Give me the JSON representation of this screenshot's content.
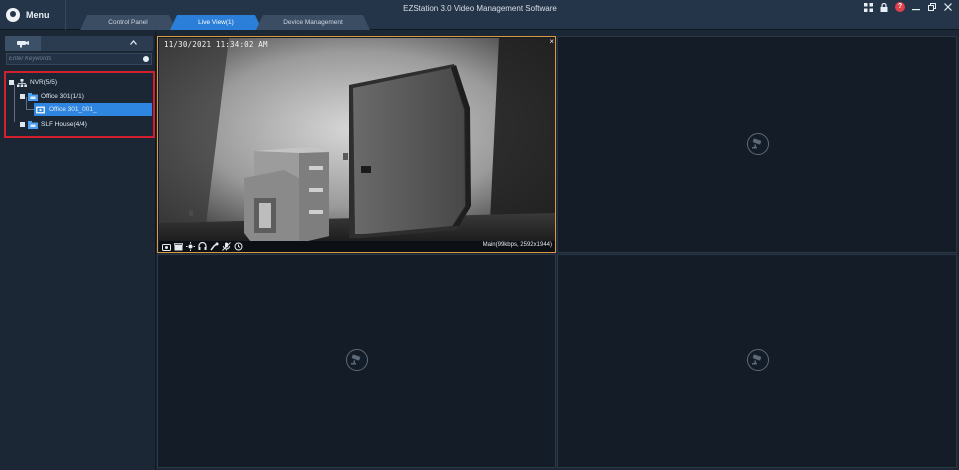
{
  "titlebar": {
    "menu_label": "Menu",
    "app_title": "EZStation 3.0 Video Management Software",
    "icons": [
      "layout-icon",
      "lock-icon",
      "help-icon",
      "minimize-icon",
      "restore-icon",
      "close-icon"
    ]
  },
  "tabs": [
    {
      "label": "Control Panel",
      "active": false
    },
    {
      "label": "Live View(1)",
      "active": true
    },
    {
      "label": "Device Management",
      "active": false
    }
  ],
  "sidebar": {
    "search_placeholder": "Enter Keywords",
    "tree": {
      "nvr": {
        "label": "NVR(5/5)"
      },
      "office": {
        "label": "Office 301(1/1)"
      },
      "camera": {
        "label": "Office 301_001_"
      },
      "house": {
        "label": "SLF House(4/4)"
      }
    }
  },
  "live_view": {
    "timestamp": "11/30/2021 11:34:02 AM",
    "stream_info": "Main(99kbps, 2592x1944)",
    "close_label": "×",
    "toolbar_icons": [
      "snapshot-icon",
      "record-icon",
      "brightness-icon",
      "audio-icon",
      "ptz-icon",
      "mute-icon",
      "refresh-icon"
    ]
  },
  "colors": {
    "accent": "#2e86e0",
    "selection_border": "#d99a40",
    "highlight_box": "#d2202f"
  }
}
